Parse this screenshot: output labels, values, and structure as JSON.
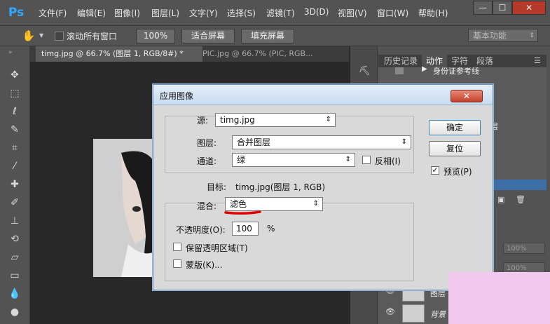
{
  "app": {
    "logo": "Ps"
  },
  "menubar": {
    "items": [
      "文件(F)",
      "编辑(E)",
      "图像(I)",
      "图层(L)",
      "文字(Y)",
      "选择(S)",
      "滤镜(T)",
      "3D(D)",
      "视图(V)",
      "窗口(W)",
      "帮助(H)"
    ],
    "window_buttons": [
      "—",
      "☐",
      "✕"
    ]
  },
  "options_bar": {
    "tool_icon": "hand-icon",
    "scroll_all_label": "滚动所有窗口",
    "zoom_label": "100%",
    "fit_screen_label": "适合屏幕",
    "fill_screen_label": "填充屏幕",
    "workspace": "基本功能"
  },
  "doc_tabs": [
    {
      "label": "timg.jpg @ 66.7% (图层 1, RGB/8#) *",
      "active": true
    },
    {
      "label": "PIC.jpg @ 66.7% (PIC, RGB...",
      "active": false
    }
  ],
  "right_panel": {
    "tabs": [
      "历史记录",
      "动作",
      "字符",
      "段落"
    ],
    "visible_text": [
      "身份证参考线",
      "层",
      "100%",
      "100%",
      "图层",
      "背景"
    ]
  },
  "dialog": {
    "title": "应用图像",
    "close": "✕",
    "source": {
      "label": "源:",
      "value": "timg.jpg"
    },
    "layer": {
      "label": "图层:",
      "value": "合并图层"
    },
    "channel": {
      "label": "通道:",
      "value": "绿"
    },
    "invert_label": "反相(I)",
    "target": {
      "label": "目标:",
      "value": "timg.jpg(图层 1, RGB)"
    },
    "blend": {
      "label": "混合:",
      "value": "滤色"
    },
    "opacity": {
      "label": "不透明度(O):",
      "value": "100",
      "unit": "%"
    },
    "preserve_transparency_label": "保留透明区域(T)",
    "mask_label": "蒙版(K)...",
    "ok_label": "确定",
    "reset_label": "复位",
    "preview_label": "预览(P)",
    "preview_checked": true
  },
  "colors": {
    "accent": "#31a8ff",
    "annotation": "#e00000",
    "pink": "#f2c9ee"
  }
}
